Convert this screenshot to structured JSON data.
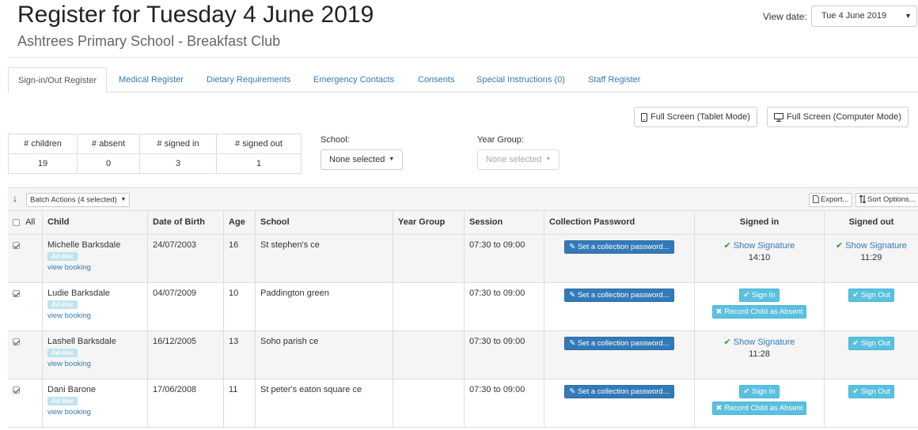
{
  "header": {
    "title": "Register for Tuesday 4 June 2019",
    "subtitle": "Ashtrees Primary School - Breakfast Club",
    "view_date_label": "View date:",
    "view_date_value": "Tue 4 June 2019",
    "view_date_caret": "▼"
  },
  "tabs": [
    {
      "label": "Sign-in/Out Register"
    },
    {
      "label": "Medical Register"
    },
    {
      "label": "Dietary Requirements"
    },
    {
      "label": "Emergency Contacts"
    },
    {
      "label": "Consents"
    },
    {
      "label": "Special Instructions (0)"
    },
    {
      "label": "Staff Register"
    }
  ],
  "fullscreen": {
    "tablet_label": "Full Screen (Tablet Mode)",
    "computer_label": "Full Screen (Computer Mode)"
  },
  "summary": {
    "headers": [
      "# children",
      "# absent",
      "# signed in",
      "# signed out"
    ],
    "values": [
      "19",
      "0",
      "3",
      "1"
    ]
  },
  "filters": {
    "school_label": "School:",
    "school_value": "None selected",
    "year_label": "Year Group:",
    "year_value": "None selected",
    "caret": "▼"
  },
  "toolbar": {
    "arrow": "↓",
    "batch_actions_label": "Batch Actions (4 selected)",
    "export_label": "Export...",
    "sort_label": "Sort Options..."
  },
  "table": {
    "columns": {
      "all": "All",
      "child": "Child",
      "dob": "Date of Birth",
      "age": "Age",
      "school": "School",
      "year_group": "Year Group",
      "session": "Session",
      "collection_password": "Collection Password",
      "signed_in": "Signed in",
      "signed_out": "Signed out"
    },
    "adhoc_badge": "Ad-Hoc",
    "view_booking_label": "view booking",
    "set_password_label": "Set a collection password...",
    "sign_in_label": "Sign In",
    "sign_out_label": "Sign Out",
    "record_absent_label": "Record Child as Absent",
    "show_signature_label": "Show Signature",
    "rows": [
      {
        "name": "Michelle Barksdale",
        "dob": "24/07/2003",
        "age": "16",
        "school": "St stephen's ce",
        "session": "07:30 to 09:00",
        "signed_in_time": "14:10",
        "signed_out_time": "11:29"
      },
      {
        "name": "Ludie Barksdale",
        "dob": "04/07/2009",
        "age": "10",
        "school": "Paddington green",
        "session": "07:30 to 09:00"
      },
      {
        "name": "Lashell Barksdale",
        "dob": "16/12/2005",
        "age": "13",
        "school": "Soho parish ce",
        "session": "07:30 to 09:00",
        "signed_in_time": "11:28"
      },
      {
        "name": "Dani Barone",
        "dob": "17/06/2008",
        "age": "11",
        "school": "St peter's eaton square ce",
        "session": "07:30 to 09:00"
      }
    ]
  }
}
